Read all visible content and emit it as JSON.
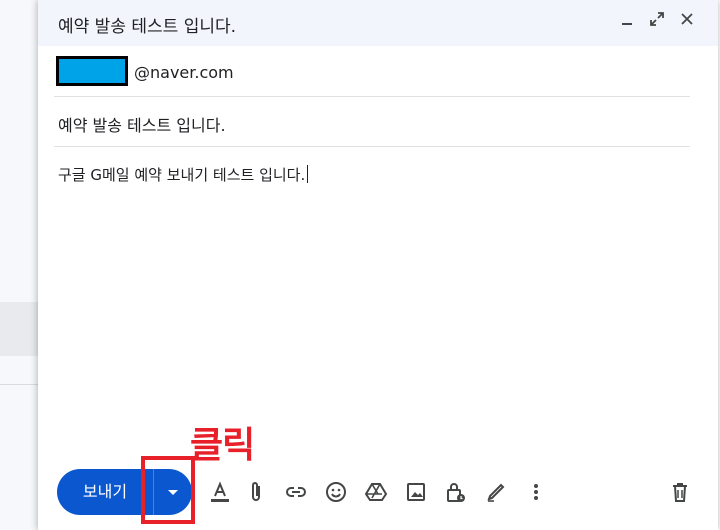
{
  "compose": {
    "title": "예약 발송 테스트 입니다.",
    "to_domain": "@naver.com",
    "subject": "예약 발송 테스트 입니다.",
    "body": "구글 G메일 예약 보내기 테스트 입니다."
  },
  "annotation": {
    "text": "클릭"
  },
  "send": {
    "label": "보내기"
  },
  "colors": {
    "accent": "#0b57d0",
    "annotation": "#e8202a",
    "redaction": "#00a2e8"
  },
  "icons": [
    "minimize-icon",
    "expand-icon",
    "close-icon",
    "format-text-icon",
    "attach-icon",
    "link-icon",
    "emoji-icon",
    "drive-icon",
    "image-icon",
    "confidential-icon",
    "signature-icon",
    "more-options-icon",
    "trash-icon"
  ]
}
